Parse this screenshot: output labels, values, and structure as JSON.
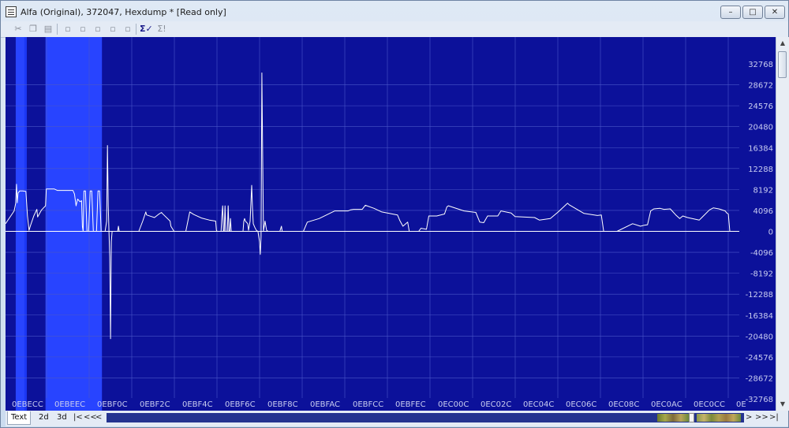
{
  "window": {
    "title": "Alfa (Original), 372047, Hexdump *   [Read only]",
    "controls": {
      "minimize": "–",
      "maximize": "□",
      "close": "✕"
    }
  },
  "toolbar": {
    "icons": [
      "cut-icon",
      "copy-icon",
      "paste-icon",
      "doc-add-icon",
      "doc-down-icon",
      "doc-sub-icon",
      "doc-mul-icon",
      "doc-up-icon",
      "sigma-check-icon",
      "sigma-icon"
    ],
    "sigma_label": "Σ✓",
    "sigma2_label": "Σ!"
  },
  "chart_data": {
    "type": "line",
    "title": "",
    "xlabel": "",
    "ylabel": "",
    "x_tick_labels": [
      "0EBECC",
      "0EBEEC",
      "0EBF0C",
      "0EBF2C",
      "0EBF4C",
      "0EBF6C",
      "0EBF8C",
      "0EBFAC",
      "0EBFCC",
      "0EBFEC",
      "0EC00C",
      "0EC02C",
      "0EC04C",
      "0EC06C",
      "0EC08C",
      "0EC0AC",
      "0EC0CC",
      "0E"
    ],
    "y_tick_labels": [
      "32768",
      "28672",
      "24576",
      "20480",
      "16384",
      "12288",
      "8192",
      "4096",
      "0",
      "-4096",
      "-8192",
      "-12288",
      "-16384",
      "-20480",
      "-24576",
      "-28672",
      "-32768"
    ],
    "ylim": [
      -32768,
      32768
    ],
    "grid": true,
    "colors": {
      "background": "#0c119a",
      "highlight_dark": "#1b37f5",
      "highlight_bright": "#2844ff",
      "line": "#ffffff",
      "grid": "#4a56c8"
    },
    "highlight_regions": [
      {
        "from": 13,
        "to": 27,
        "shade": "bright"
      },
      {
        "from": 51,
        "to": 123,
        "shade": "bright"
      }
    ],
    "series": [
      {
        "points": [
          [
            0,
            1500
          ],
          [
            4,
            2400
          ],
          [
            8,
            3300
          ],
          [
            11,
            4000
          ],
          [
            13,
            5500
          ],
          [
            14,
            9200
          ],
          [
            15,
            5600
          ],
          [
            16,
            7500
          ],
          [
            18,
            7900
          ],
          [
            22,
            7900
          ],
          [
            26,
            7800
          ],
          [
            28,
            3000
          ],
          [
            30,
            200
          ],
          [
            32,
            1200
          ],
          [
            36,
            3000
          ],
          [
            40,
            4300
          ],
          [
            41,
            2800
          ],
          [
            46,
            4200
          ],
          [
            51,
            5000
          ],
          [
            52,
            8300
          ],
          [
            62,
            8300
          ],
          [
            66,
            8000
          ],
          [
            86,
            8000
          ],
          [
            88,
            7300
          ],
          [
            90,
            5000
          ],
          [
            92,
            6300
          ],
          [
            95,
            5800
          ],
          [
            97,
            6000
          ],
          [
            98,
            1000
          ],
          [
            99,
            0
          ],
          [
            100,
            7900
          ],
          [
            102,
            7900
          ],
          [
            104,
            0
          ],
          [
            106,
            0
          ],
          [
            108,
            7900
          ],
          [
            110,
            7900
          ],
          [
            112,
            0
          ],
          [
            116,
            0
          ],
          [
            118,
            7900
          ],
          [
            120,
            7900
          ],
          [
            122,
            0
          ],
          [
            126,
            0
          ],
          [
            127,
            0
          ],
          [
            129,
            2000
          ],
          [
            130,
            16800
          ],
          [
            131,
            5000
          ],
          [
            132,
            0
          ],
          [
            133,
            -5000
          ],
          [
            134,
            -21000
          ],
          [
            135,
            -2000
          ],
          [
            136,
            0
          ],
          [
            143,
            0
          ],
          [
            144,
            1000
          ],
          [
            145,
            0
          ],
          [
            170,
            0
          ],
          [
            175,
            2000
          ],
          [
            179,
            3800
          ],
          [
            180,
            3200
          ],
          [
            186,
            2900
          ],
          [
            190,
            2700
          ],
          [
            195,
            3300
          ],
          [
            199,
            3700
          ],
          [
            200,
            3500
          ],
          [
            210,
            2000
          ],
          [
            211,
            1000
          ],
          [
            215,
            0
          ],
          [
            230,
            0
          ],
          [
            235,
            3800
          ],
          [
            240,
            3300
          ],
          [
            250,
            2600
          ],
          [
            260,
            2200
          ],
          [
            268,
            2000
          ],
          [
            269,
            200
          ],
          [
            270,
            0
          ],
          [
            275,
            0
          ],
          [
            276,
            3000
          ],
          [
            277,
            5000
          ],
          [
            278,
            0
          ],
          [
            279,
            0
          ],
          [
            280,
            5000
          ],
          [
            281,
            0
          ],
          [
            283,
            0
          ],
          [
            284,
            5000
          ],
          [
            285,
            0
          ],
          [
            286,
            0
          ],
          [
            287,
            2500
          ],
          [
            288,
            0
          ],
          [
            303,
            0
          ],
          [
            304,
            2000
          ],
          [
            305,
            2500
          ],
          [
            306,
            2000
          ],
          [
            309,
            1500
          ],
          [
            310,
            200
          ],
          [
            312,
            2000
          ],
          [
            314,
            9000
          ],
          [
            315,
            4500
          ],
          [
            316,
            1500
          ],
          [
            318,
            800
          ],
          [
            320,
            200
          ],
          [
            322,
            0
          ],
          [
            324,
            -2000
          ],
          [
            325,
            -4500
          ],
          [
            326,
            -1000
          ],
          [
            327,
            31000
          ],
          [
            328,
            15000
          ],
          [
            329,
            0
          ],
          [
            331,
            2000
          ],
          [
            333,
            200
          ],
          [
            335,
            0
          ],
          [
            350,
            0
          ],
          [
            352,
            1000
          ],
          [
            353,
            0
          ],
          [
            380,
            0
          ],
          [
            385,
            1800
          ],
          [
            400,
            2500
          ],
          [
            420,
            4000
          ],
          [
            425,
            4000
          ],
          [
            432,
            4000
          ],
          [
            437,
            4000
          ],
          [
            440,
            4200
          ],
          [
            444,
            4300
          ],
          [
            455,
            4300
          ],
          [
            459,
            5100
          ],
          [
            470,
            4500
          ],
          [
            480,
            3800
          ],
          [
            500,
            3200
          ],
          [
            503,
            2100
          ],
          [
            507,
            1000
          ],
          [
            513,
            1800
          ],
          [
            515,
            0
          ],
          [
            520,
            0
          ],
          [
            527,
            0
          ],
          [
            530,
            600
          ],
          [
            537,
            400
          ],
          [
            540,
            3000
          ],
          [
            550,
            3000
          ],
          [
            560,
            3400
          ],
          [
            563,
            4800
          ],
          [
            565,
            5000
          ],
          [
            585,
            4000
          ],
          [
            600,
            3700
          ],
          [
            605,
            1800
          ],
          [
            610,
            1700
          ],
          [
            615,
            3000
          ],
          [
            628,
            3000
          ],
          [
            632,
            4000
          ],
          [
            645,
            3600
          ],
          [
            650,
            2900
          ],
          [
            675,
            2700
          ],
          [
            681,
            2200
          ],
          [
            695,
            2500
          ],
          [
            705,
            3800
          ],
          [
            717,
            5500
          ],
          [
            719,
            5200
          ],
          [
            738,
            3500
          ],
          [
            755,
            3100
          ],
          [
            760,
            3200
          ],
          [
            763,
            0
          ],
          [
            780,
            0
          ],
          [
            800,
            1500
          ],
          [
            810,
            1000
          ],
          [
            815,
            1200
          ],
          [
            819,
            1300
          ],
          [
            823,
            4000
          ],
          [
            827,
            4400
          ],
          [
            835,
            4500
          ],
          [
            840,
            4300
          ],
          [
            848,
            4400
          ],
          [
            855,
            3200
          ],
          [
            860,
            2500
          ],
          [
            864,
            3000
          ],
          [
            870,
            2700
          ],
          [
            885,
            2200
          ],
          [
            898,
            4200
          ],
          [
            903,
            4600
          ],
          [
            910,
            4400
          ],
          [
            912,
            4300
          ],
          [
            918,
            4000
          ],
          [
            920,
            3600
          ],
          [
            922,
            3400
          ],
          [
            924,
            0
          ],
          [
            926,
            0
          ],
          [
            930,
            0
          ]
        ]
      }
    ]
  },
  "bottom": {
    "tabs": [
      "Text",
      "2d",
      "3d"
    ],
    "nav_left": [
      "|<",
      "<<",
      "<"
    ],
    "nav_right": [
      ">",
      ">>",
      ">|"
    ]
  }
}
